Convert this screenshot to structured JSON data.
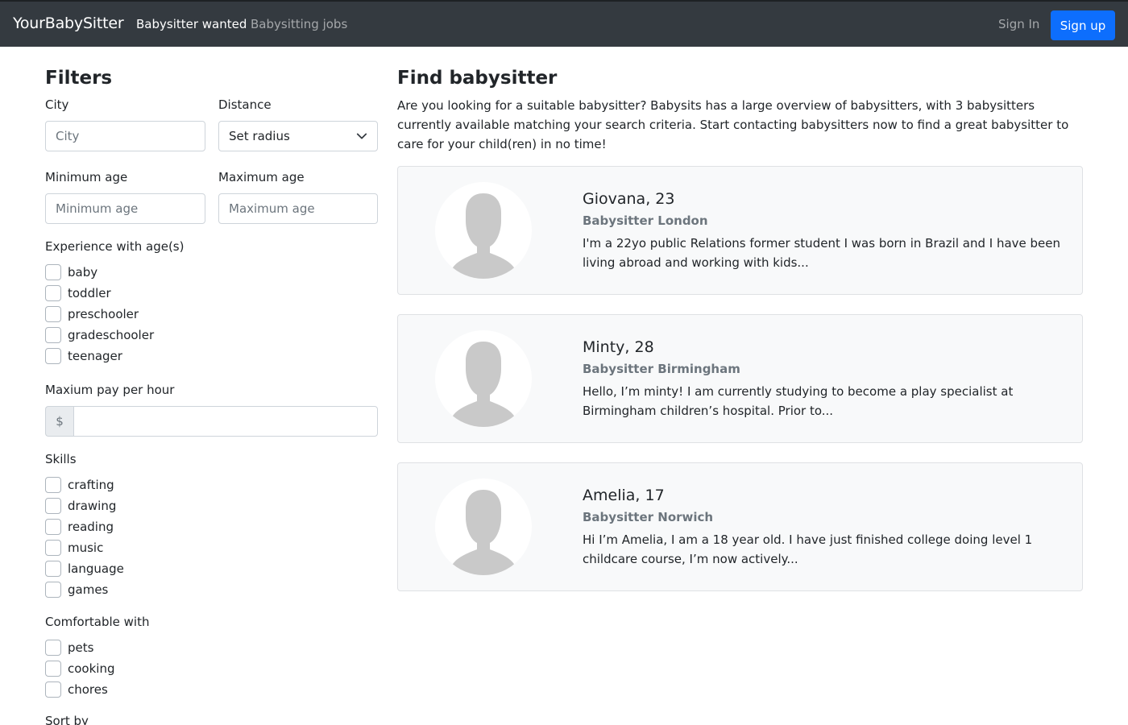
{
  "nav": {
    "brand": "YourBabySitter",
    "links": [
      "Babysitter wanted",
      "Babysitting jobs"
    ],
    "signin": "Sign In",
    "signup": "Sign up"
  },
  "filters": {
    "title": "Filters",
    "city_label": "City",
    "city_placeholder": "City",
    "distance_label": "Distance",
    "distance_value": "Set radius",
    "min_age_label": "Minimum age",
    "min_age_placeholder": "Minimum age",
    "max_age_label": "Maximum age",
    "max_age_placeholder": "Maximum age",
    "experience_label": "Experience with age(s)",
    "experience": [
      "baby",
      "toddler",
      "preschooler",
      "gradeschooler",
      "teenager"
    ],
    "pay_label": "Maxium pay per hour",
    "pay_prefix": "$",
    "pay_value": "",
    "skills_label": "Skills",
    "skills": [
      "crafting",
      "drawing",
      "reading",
      "music",
      "language",
      "games"
    ],
    "comfortable_label": "Comfortable with",
    "comfortable": [
      "pets",
      "cooking",
      "chores"
    ],
    "sort_label": "Sort by"
  },
  "main": {
    "title": "Find babysitter",
    "intro": "Are you looking for a suitable babysitter? Babysits has a large overview of babysitters, with 3 babysitters currently available matching your search criteria. Start contacting babysitters now to find a great babysitter to care for your child(ren) in no time!",
    "cards": [
      {
        "name": "Giovana, 23",
        "subtitle": "Babysitter London",
        "desc": "I'm a 22yo public Relations former student I was born in Brazil and I have been living abroad and working with kids..."
      },
      {
        "name": "Minty, 28",
        "subtitle": "Babysitter Birmingham",
        "desc": "Hello, I’m minty! I am currently studying to become a play specialist at Birmingham children’s hospital. Prior to..."
      },
      {
        "name": "Amelia, 17",
        "subtitle": "Babysitter Norwich",
        "desc": "Hi I’m Amelia, I am a 18 year old. I have just finished college doing level 1 childcare course, I’m now actively..."
      }
    ]
  },
  "colors": {
    "navbar": "#343a40",
    "primary": "#0d6efd",
    "card_bg": "#f8f9fa",
    "muted": "#6c757d"
  }
}
